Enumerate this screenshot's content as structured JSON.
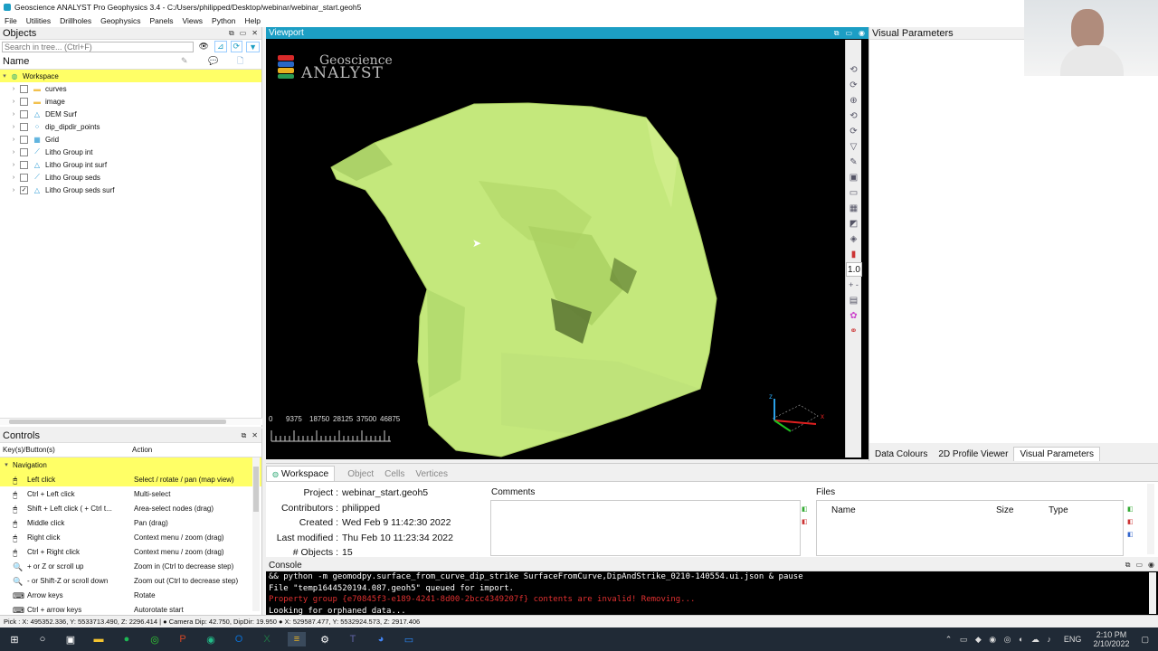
{
  "app": {
    "title": "Geoscience ANALYST Pro Geophysics 3.4 - C:/Users/philipped/Desktop/webinar/webinar_start.geoh5",
    "menu": [
      "File",
      "Utilities",
      "Drillholes",
      "Geophysics",
      "Panels",
      "Views",
      "Python",
      "Help"
    ]
  },
  "objects": {
    "title": "Objects",
    "search_placeholder": "Search in tree... (Ctrl+F)",
    "col_name": "Name",
    "workspace": "Workspace",
    "items": [
      {
        "label": "curves",
        "icon": "folder-icon",
        "checked": false
      },
      {
        "label": "image",
        "icon": "folder-icon",
        "checked": false
      },
      {
        "label": "DEM Surf",
        "icon": "surface-icon",
        "checked": false
      },
      {
        "label": "dip_dipdir_points",
        "icon": "points-icon",
        "checked": false
      },
      {
        "label": "Grid",
        "icon": "grid-icon",
        "checked": false
      },
      {
        "label": "Litho Group int",
        "icon": "curve-icon",
        "checked": false
      },
      {
        "label": "Litho Group int surf",
        "icon": "surface-icon",
        "checked": false
      },
      {
        "label": "Litho Group seds",
        "icon": "curve-icon",
        "checked": false
      },
      {
        "label": "Litho Group seds surf",
        "icon": "surface-icon",
        "checked": true
      }
    ]
  },
  "controls": {
    "title": "Controls",
    "col_key": "Key(s)/Button(s)",
    "col_action": "Action",
    "group": "Navigation",
    "rows": [
      {
        "key": "Left click",
        "action": "Select / rotate / pan (map view)"
      },
      {
        "key": "Ctrl + Left click",
        "action": "Multi-select"
      },
      {
        "key": "Shift + Left click ( + Ctrl t...",
        "action": "Area-select nodes (drag)"
      },
      {
        "key": "Middle click",
        "action": "Pan (drag)"
      },
      {
        "key": "Right click",
        "action": "Context menu / zoom (drag)"
      },
      {
        "key": "Ctrl + Right click",
        "action": "Context menu / zoom (drag)"
      },
      {
        "key": "+ or Z or scroll up",
        "action": "Zoom in (Ctrl to decrease step)"
      },
      {
        "key": "- or Shift-Z or scroll down",
        "action": "Zoom out (Ctrl to decrease step)"
      },
      {
        "key": "Arrow keys",
        "action": "Rotate"
      },
      {
        "key": "Ctrl + arrow keys",
        "action": "Autorotate start"
      }
    ]
  },
  "viewport": {
    "title": "Viewport",
    "logo_line1": "Geoscience",
    "logo_line2": "ANALYST",
    "scale_labels": [
      "0",
      "9375",
      "18750",
      "28125",
      "37500",
      "46875"
    ],
    "zoom_value": "1.0"
  },
  "visual_params": {
    "title": "Visual Parameters",
    "tabs": [
      "Data Colours",
      "2D Profile Viewer",
      "Visual Parameters"
    ]
  },
  "workspace_panel": {
    "tabs": [
      "Workspace",
      "Object",
      "Cells",
      "Vertices"
    ],
    "fields": [
      {
        "label": "Project :",
        "value": "webinar_start.geoh5"
      },
      {
        "label": "Contributors :",
        "value": "philipped"
      },
      {
        "label": "Created :",
        "value": "Wed Feb 9 11:42:30 2022"
      },
      {
        "label": "Last modified :",
        "value": "Thu Feb 10 11:23:34 2022"
      },
      {
        "label": "# Objects :",
        "value": "15"
      }
    ],
    "comments_label": "Comments",
    "files_label": "Files",
    "files_cols": [
      "Name",
      "Size",
      "Type"
    ]
  },
  "console": {
    "title": "Console",
    "lines": [
      {
        "text": "&& python -m geomodpy.surface_from_curve_dip_strike SurfaceFromCurve,DipAndStrike_0210-140554.ui.json & pause",
        "color": "#ffffff"
      },
      {
        "text": "File \"temp1644520194.087.geoh5\" queued for import.",
        "color": "#ffffff"
      },
      {
        "text": "Property group {e70845f3-e189-4241-8d00-2bcc4349207f} contents are invalid! Removing...",
        "color": "#e03030"
      },
      {
        "text": "Looking for orphaned data...",
        "color": "#ffffff"
      }
    ]
  },
  "statusbar": {
    "text": "Pick : X: 495352.336, Y: 5533713.490, Z: 2296.414 |  ●  Camera Dip: 42.750, DipDir: 19.950  ●  X: 529587.477, Y: 5532924.573, Z: 2917.406"
  },
  "taskbar": {
    "lang": "ENG",
    "time": "2:10 PM",
    "date": "2/10/2022"
  },
  "colors": {
    "accent": "#1c9ec4",
    "highlight": "#ffff33",
    "surface": "#c6ea7f",
    "viewport_bg": "#000000"
  }
}
